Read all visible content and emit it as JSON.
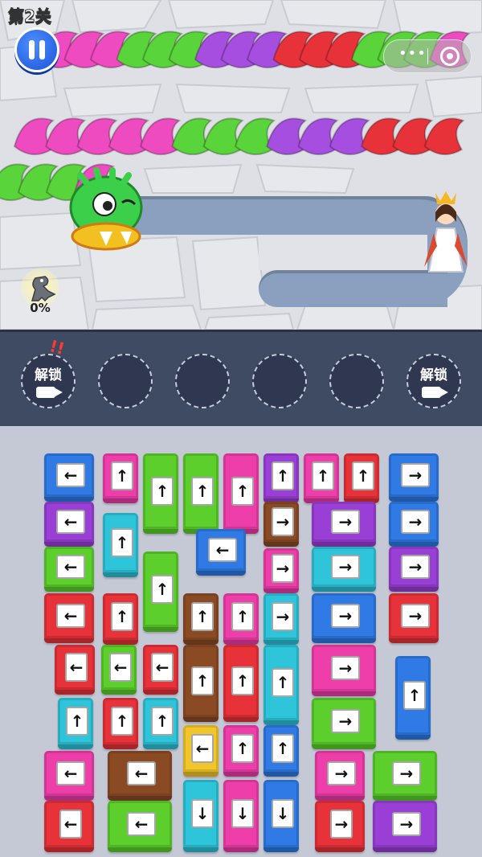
{
  "hud": {
    "level": "第2关",
    "progress": "0%"
  },
  "slots": {
    "lock_label": "解锁",
    "alert": "!!"
  },
  "colors": {
    "blue": "#2f7ae5",
    "pink": "#ee3ea9",
    "green": "#5ccf2c",
    "red": "#e8323a",
    "purple": "#9a3fd6",
    "cyan": "#2ec4d9",
    "brown": "#8a4a24",
    "yellow": "#f1c62a"
  },
  "icons": {
    "pause": "pause-icon",
    "menu": "more-icon",
    "record": "record-icon",
    "video": "video-icon",
    "dino": "dino-icon",
    "princess": "princess-icon",
    "dragon": "dragon-head-icon"
  },
  "boxes": [
    {
      "c": "blue",
      "d": "←"
    },
    {
      "c": "pink",
      "d": "↑"
    },
    {
      "c": "green",
      "d": "↑"
    },
    {
      "c": "green",
      "d": "↑"
    },
    {
      "c": "pink",
      "d": "↑"
    },
    {
      "c": "purple",
      "d": "↑"
    },
    {
      "c": "pink",
      "d": "↑"
    },
    {
      "c": "red",
      "d": "↑"
    },
    {
      "c": "blue",
      "d": "→"
    },
    {
      "c": "purple",
      "d": "←"
    },
    {
      "c": "cyan",
      "d": "↑"
    },
    {
      "c": "blue",
      "d": "←"
    },
    {
      "c": "brown",
      "d": "→"
    },
    {
      "c": "purple",
      "d": "→"
    },
    {
      "c": "blue",
      "d": "→"
    },
    {
      "c": "green",
      "d": "←"
    },
    {
      "c": "green",
      "d": "↑"
    },
    {
      "c": "pink",
      "d": "→"
    },
    {
      "c": "cyan",
      "d": "→"
    },
    {
      "c": "purple",
      "d": "→"
    },
    {
      "c": "red",
      "d": "←"
    },
    {
      "c": "red",
      "d": "↑"
    },
    {
      "c": "brown",
      "d": "↑"
    },
    {
      "c": "pink",
      "d": "↑"
    },
    {
      "c": "cyan",
      "d": "→"
    },
    {
      "c": "blue",
      "d": "→"
    },
    {
      "c": "red",
      "d": "→"
    },
    {
      "c": "red",
      "d": "←"
    },
    {
      "c": "green",
      "d": "←"
    },
    {
      "c": "red",
      "d": "←"
    },
    {
      "c": "brown",
      "d": "↑"
    },
    {
      "c": "red",
      "d": "↑"
    },
    {
      "c": "cyan",
      "d": "↑"
    },
    {
      "c": "pink",
      "d": "→"
    },
    {
      "c": "blue",
      "d": "↑"
    },
    {
      "c": "cyan",
      "d": "↑"
    },
    {
      "c": "red",
      "d": "↑"
    },
    {
      "c": "cyan",
      "d": "↑"
    },
    {
      "c": "green",
      "d": "→"
    },
    {
      "c": "yellow",
      "d": "←"
    },
    {
      "c": "pink",
      "d": "↑"
    },
    {
      "c": "blue",
      "d": "↑"
    },
    {
      "c": "pink",
      "d": "←"
    },
    {
      "c": "brown",
      "d": "←"
    },
    {
      "c": "pink",
      "d": "→"
    },
    {
      "c": "green",
      "d": "→"
    },
    {
      "c": "cyan",
      "d": "↓"
    },
    {
      "c": "pink",
      "d": "↓"
    },
    {
      "c": "blue",
      "d": "↓"
    },
    {
      "c": "red",
      "d": "←"
    },
    {
      "c": "green",
      "d": "←"
    },
    {
      "c": "red",
      "d": "→"
    },
    {
      "c": "purple",
      "d": "→"
    }
  ]
}
